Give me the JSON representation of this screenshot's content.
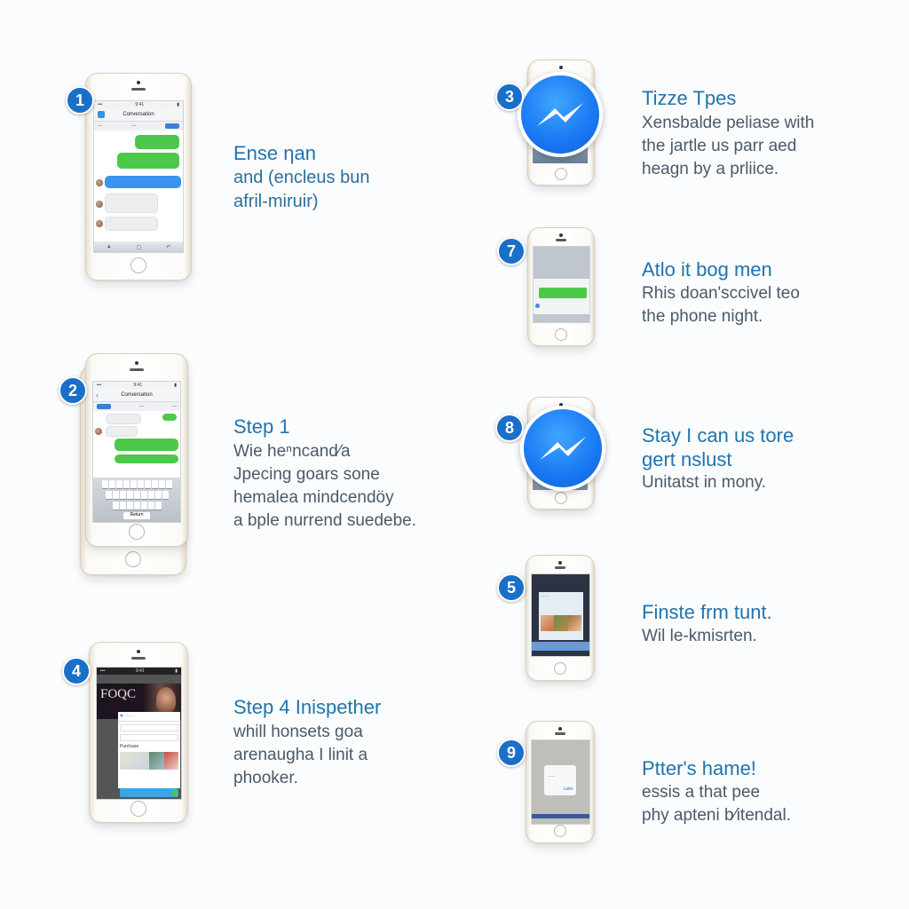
{
  "steps": [
    {
      "number": "1",
      "title": "Ense ηan",
      "lines": [
        "and (encleus bun",
        "afril-miruir)"
      ],
      "screen": "chat",
      "chat_title": "Conversation"
    },
    {
      "number": "2",
      "title": "Step 1",
      "lines": [
        "Wie heⁿncand⁄a",
        "Jpecing goars sone",
        "hemalea mindcendöy",
        "a bple nurrend suedebe."
      ],
      "screen": "chat-keyboard",
      "chat_title": "Conversation",
      "send_label": "Return"
    },
    {
      "number": "3",
      "title": "Tizze Tpes",
      "lines": [
        "Xensbalde peliase with",
        "the jartle us parr aed",
        "heagn by a prliice."
      ],
      "screen": "messenger"
    },
    {
      "number": "4",
      "title": "Step 4 Inispether",
      "lines": [
        "whill honsets goa",
        "arenaugha I linit a",
        "phooker."
      ],
      "screen": "web",
      "web_logo": "FOQC",
      "web_section": "Purchase"
    },
    {
      "number": "5",
      "title": "Finste frm tunt.",
      "lines": [
        "Wil le-kmisrten."
      ],
      "screen": "gallery"
    },
    {
      "number": "7",
      "title": "Atlo it bog men",
      "lines": [
        "Rhis doan'sccivel teo",
        "the phone night."
      ],
      "screen": "share"
    },
    {
      "number": "8",
      "title": "Stay I can us tore",
      "title2": "gert nslust",
      "lines": [
        "Unitatst in mony."
      ],
      "screen": "messenger"
    },
    {
      "number": "9",
      "title": "Ptter's hame!",
      "lines": [
        "essis a that pee",
        "phy apteni b⁄itendal."
      ],
      "screen": "alert",
      "alert_button": "Later"
    }
  ],
  "colors": {
    "accent": "#2174ad",
    "badge": "#1a6fc9",
    "messenger": "#1877f2",
    "bubble_green": "#4cc84a",
    "bubble_blue": "#3a93f0"
  }
}
